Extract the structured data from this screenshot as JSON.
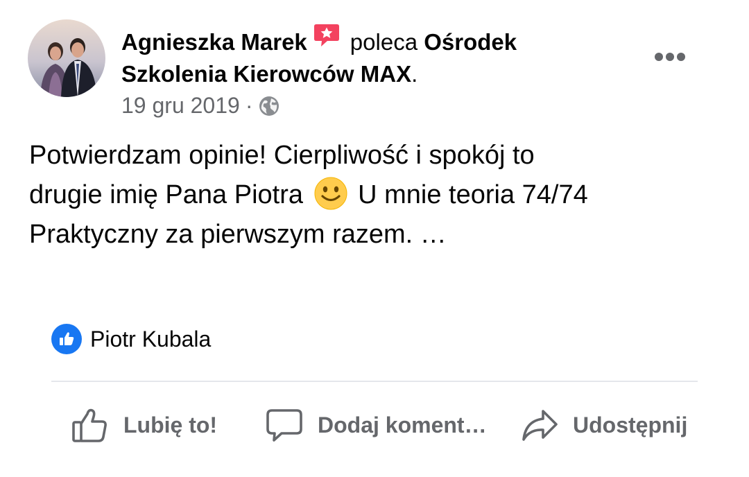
{
  "post": {
    "author": "Agnieszka Marek",
    "recommends_word": "poleca",
    "page_name_line1": "Ośrodek",
    "page_name_line2": "Szkolenia Kierowców MAX",
    "period": ".",
    "date": "19 gru 2019",
    "separator": "·",
    "body": {
      "line1": "Potwierdzam opinie! Cierpliwość i spokój to",
      "line2_before_emoji": "drugie imię Pana Piotra",
      "line2_after_emoji": "U mnie teoria 74/74",
      "line3": "Praktyczny za pierwszym razem. …"
    },
    "icons": {
      "recommend": "recommend-star-icon",
      "privacy": "globe-icon",
      "emoji": "slightly-smiling-face",
      "more": "more-options-icon"
    }
  },
  "reactions": {
    "type": "like",
    "names": "Piotr Kubala"
  },
  "actions": {
    "like_label": "Lubię to!",
    "comment_label": "Dodaj koment…",
    "share_label": "Udostępnij"
  },
  "colors": {
    "accent_blue": "#1877f2",
    "recommend_red": "#f3425f",
    "secondary_text": "#65676b",
    "divider": "#e4e6eb",
    "emoji_yellow": "#ffcc4d"
  }
}
